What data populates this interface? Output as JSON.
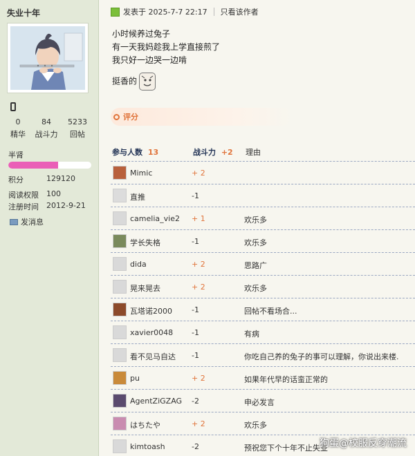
{
  "profile": {
    "username": "失业十年",
    "stats": [
      {
        "value": "0",
        "label": "精华"
      },
      {
        "value": "84",
        "label": "战斗力"
      },
      {
        "value": "5233",
        "label": "回帖"
      }
    ],
    "rank": "半肾",
    "rank_progress": 0.6,
    "points_label": "积分",
    "points": "129120",
    "read_perm_label": "阅读权限",
    "read_perm": "100",
    "reg_label": "注册时间",
    "reg_date": "2012-9-21",
    "send_msg": "发消息"
  },
  "post": {
    "posted_at": "发表于 2025-7-7 22:17",
    "author_only": "只看该作者",
    "lines": [
      "小时候养过兔子",
      "有一天我妈趁我上学直接煎了",
      "我只好一边哭一边啃",
      "挺香的"
    ],
    "rate_label": "评分"
  },
  "rating": {
    "participants_label": "参与人数",
    "participants": "13",
    "power_label": "战斗力",
    "power_total": "+2",
    "reason_label": "理由",
    "rows": [
      {
        "name": "Mimic",
        "score": "+ 2",
        "reason": "",
        "avatar_color": "#b8603c"
      },
      {
        "name": "直推",
        "score": "-1",
        "reason": "",
        "avatar_color": "#dcdcdc"
      },
      {
        "name": "camelia_vie2",
        "score": "+ 1",
        "reason": "欢乐多",
        "avatar_color": "#d9d9d9"
      },
      {
        "name": "学长失格",
        "score": "-1",
        "reason": "欢乐多",
        "avatar_color": "#7a8a5c"
      },
      {
        "name": "dida",
        "score": "+ 2",
        "reason": "思路广",
        "avatar_color": "#d9d9d9"
      },
      {
        "name": "晃来晃去",
        "score": "+ 2",
        "reason": "欢乐多",
        "avatar_color": "#d9d9d9"
      },
      {
        "name": "瓦塔诺2000",
        "score": "-1",
        "reason": "回帖不看场合...",
        "avatar_color": "#8c4a2a"
      },
      {
        "name": "xavier0048",
        "score": "-1",
        "reason": "有病",
        "avatar_color": "#d9d9d9"
      },
      {
        "name": "看不见马自达",
        "score": "-1",
        "reason": "你吃自己养的兔子的事可以理解，你说出来楼.",
        "avatar_color": "#d9d9d9"
      },
      {
        "name": "pu",
        "score": "+ 2",
        "reason": "如果年代早的话蛮正常的",
        "avatar_color": "#c98a3a"
      },
      {
        "name": "AgentZiGZAG",
        "score": "-2",
        "reason": "申必发言",
        "avatar_color": "#5b4b6e"
      },
      {
        "name": "はちたや",
        "score": "+ 2",
        "reason": "欢乐多",
        "avatar_color": "#c98cb0"
      },
      {
        "name": "kimtoash",
        "score": "-2",
        "reason": "预祝您下个十年不止失业",
        "avatar_color": "#d9d9d9"
      }
    ]
  },
  "watermark": "狗蛋@校服反穿潮流",
  "colors": {
    "accent_orange": "#e0733a",
    "rank_pink": "#ea5fb7",
    "sidebar_bg": "#e3e9d8",
    "page_bg": "#f7f6ef"
  }
}
